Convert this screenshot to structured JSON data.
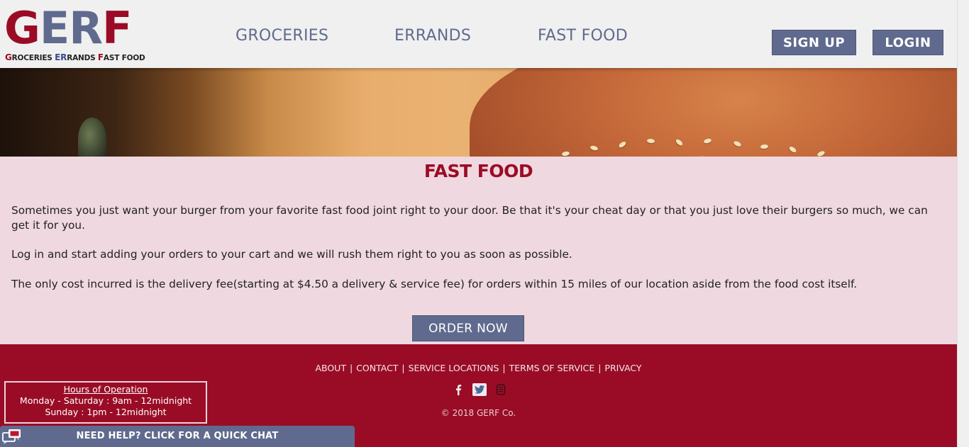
{
  "logo": {
    "big_g": "G",
    "big_er": "ER",
    "big_f": "F",
    "tag_g": "G",
    "tag_roceries": "ROCERIES ",
    "tag_er": "ER",
    "tag_rands": "RANDS ",
    "tag_f": "F",
    "tag_ast_food": "AST FOOD"
  },
  "nav": {
    "items": [
      {
        "label": "GROCERIES"
      },
      {
        "label": "ERRANDS"
      },
      {
        "label": "FAST FOOD"
      }
    ],
    "signup_label": "SIGN UP",
    "login_label": "LOGIN"
  },
  "main": {
    "title": "FAST FOOD",
    "paragraphs": [
      "Sometimes you just want your burger from your favorite fast food joint right to your door. Be that it's your cheat day or that you just love their burgers so much, we can get it for you.",
      "Log in and start adding your orders to your cart and we will rush them right to you as soon as possible.",
      "The only cost incurred is the delivery fee(starting at $4.50 a delivery & service fee) for orders within 15 miles of our location aside from the food cost itself."
    ],
    "order_label": "ORDER NOW"
  },
  "footer": {
    "links": [
      "ABOUT",
      "CONTACT",
      "SERVICE LOCATIONS",
      "TERMS OF SERVICE",
      "PRIVACY"
    ],
    "separator": "|",
    "social": [
      "facebook-icon",
      "twitter-icon",
      "instagram-icon"
    ],
    "copyright": "© 2018 GERF Co."
  },
  "hours": {
    "title": "Hours of Operation",
    "weekday": "Monday - Saturday : 9am - 12midnight",
    "sunday": "Sunday : 1pm - 12midnight"
  },
  "chat": {
    "label": "NEED HELP? CLICK FOR A QUICK CHAT"
  },
  "colors": {
    "brand_red": "#9a0c26",
    "brand_slate": "#5f6a8e",
    "content_bg": "#efd8df",
    "header_bg": "#f0f0f0"
  }
}
